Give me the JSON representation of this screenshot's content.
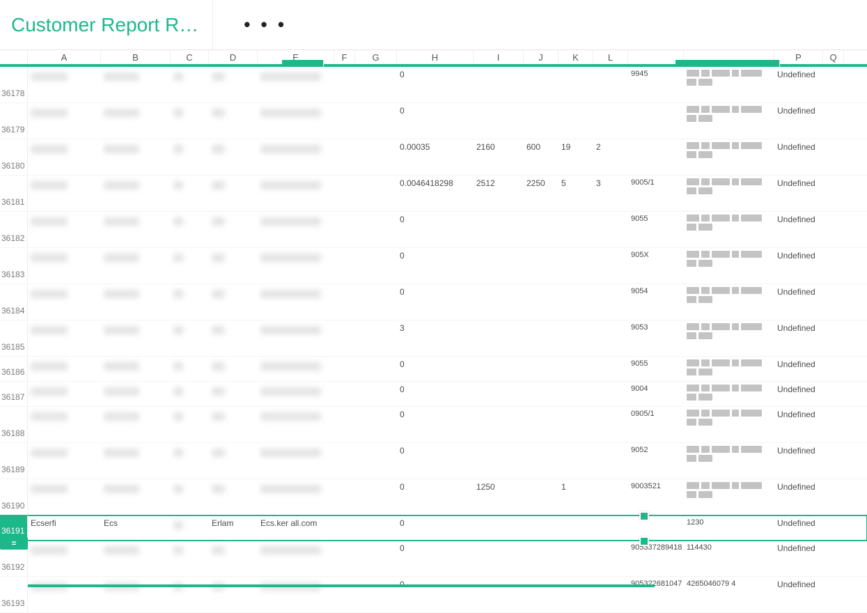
{
  "header": {
    "tab_title": "Customer Report R…",
    "more_glyph": "• • •"
  },
  "columns": [
    "",
    "A",
    "B",
    "C",
    "D",
    "E",
    "F",
    "G",
    "H",
    "I",
    "J",
    "K",
    "L",
    "",
    "",
    "P",
    "Q"
  ],
  "accent_hex": "#1cb88a",
  "undefined_label": "Undefined",
  "selected_row_id": "36191",
  "selected_row_marker": "=",
  "rows": [
    {
      "id": "36178",
      "tall": true,
      "H": "0",
      "I": "",
      "J": "",
      "K": "",
      "L": "",
      "M": "9945",
      "P": "Undefined"
    },
    {
      "id": "36179",
      "tall": true,
      "H": "0",
      "I": "",
      "J": "",
      "K": "",
      "L": "",
      "M": "",
      "P": "Undefined"
    },
    {
      "id": "36180",
      "tall": true,
      "H": "0.00035",
      "I": "2160",
      "J": "600",
      "K": "19",
      "L": "2",
      "M": "",
      "P": "Undefined"
    },
    {
      "id": "36181",
      "tall": true,
      "H": "0.0046418298",
      "I": "2512",
      "J": "2250",
      "K": "5",
      "L": "3",
      "M": "9005/1",
      "P": "Undefined"
    },
    {
      "id": "36182",
      "tall": true,
      "H": "0",
      "I": "",
      "J": "",
      "K": "",
      "L": "",
      "M": "9055",
      "P": "Undefined"
    },
    {
      "id": "36183",
      "tall": true,
      "H": "0",
      "I": "",
      "J": "",
      "K": "",
      "L": "",
      "M": "905X",
      "P": "Undefined"
    },
    {
      "id": "36184",
      "tall": true,
      "H": "0",
      "I": "",
      "J": "",
      "K": "",
      "L": "",
      "M": "9054",
      "P": "Undefined"
    },
    {
      "id": "36185",
      "tall": true,
      "H": "3",
      "I": "",
      "J": "",
      "K": "",
      "L": "",
      "M": "9053",
      "P": "Undefined"
    },
    {
      "id": "36186",
      "tall": false,
      "H": "0",
      "I": "",
      "J": "",
      "K": "",
      "L": "",
      "M": "9055",
      "P": "Undefined"
    },
    {
      "id": "36187",
      "tall": false,
      "H": "0",
      "I": "",
      "J": "",
      "K": "",
      "L": "",
      "M": "9004",
      "P": "Undefined"
    },
    {
      "id": "36188",
      "tall": true,
      "H": "0",
      "I": "",
      "J": "",
      "K": "",
      "L": "",
      "M": "0905/1",
      "P": "Undefined"
    },
    {
      "id": "36189",
      "tall": true,
      "H": "0",
      "I": "",
      "J": "",
      "K": "",
      "L": "",
      "M": "9052",
      "P": "Undefined"
    },
    {
      "id": "36190",
      "tall": true,
      "H": "0",
      "I": "1250",
      "J": "",
      "K": "1",
      "L": "",
      "M": "9003521",
      "P": "Undefined"
    },
    {
      "id": "36191",
      "tall": false,
      "sel": true,
      "A": "Ecserfi",
      "B": "Ecs",
      "D": "Erlam",
      "E": "Ecs.ker all.com",
      "H": "0",
      "I": "",
      "J": "",
      "K": "",
      "L": "",
      "M": "",
      "N": "1230",
      "P": "Undefined"
    },
    {
      "id": "36192",
      "tall": true,
      "H": "0",
      "I": "",
      "J": "",
      "K": "",
      "L": "",
      "M": "905337289418",
      "N": "114430",
      "P": "Undefined"
    },
    {
      "id": "36193",
      "tall": true,
      "H": "0",
      "I": "",
      "J": "",
      "K": "",
      "L": "",
      "M": "905322681047",
      "N": "4265046079 4",
      "P": "Undefined"
    }
  ]
}
